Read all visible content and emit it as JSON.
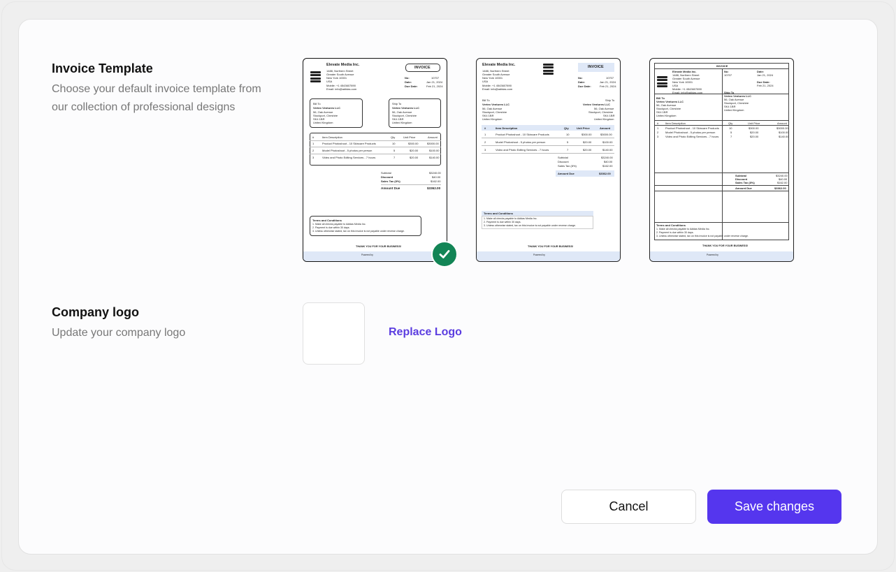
{
  "invoice_template": {
    "title": "Invoice Template",
    "description": "Choose your default invoice template from our collection of professional designs",
    "selected_index": 0
  },
  "company_logo": {
    "title": "Company logo",
    "description": "Update your company logo",
    "replace_label": "Replace Logo"
  },
  "actions": {
    "cancel_label": "Cancel",
    "save_label": "Save changes"
  },
  "colors": {
    "accent": "#5536ee",
    "link": "#5b3de0",
    "selected_check": "#138556"
  },
  "mini_invoice": {
    "company": "Elevate Media Inc.",
    "address": [
      "1488, Northern Street",
      "Greater South Avenue",
      "New York 10001",
      "USA"
    ],
    "mobile": "Mobile: +1 4543607890",
    "email": "Email: info@adidas.com",
    "heading": "INVOICE",
    "no_label": "No:",
    "no_value": "10707",
    "date_label": "Date:",
    "date_value": "Jan 21, 2024",
    "due_label": "Due Date:",
    "due_value": "Feb 21, 2024",
    "bill_to": "Bill To",
    "ship_to": "Ship To",
    "client": "Vertex Ventures LLC",
    "client_address": [
      "56, Oak Avenue",
      "Stockport, Cheshire",
      "SK4 1BR",
      "United Kingdom"
    ],
    "columns": [
      "#",
      "Item Description",
      "Qty",
      "Unit Price",
      "Amount"
    ],
    "rows": [
      [
        "1",
        "Product Photoshoot - 10 Skincare Products",
        "10",
        "$300.00",
        "$3000.00"
      ],
      [
        "2",
        "Model Photoshoot - 5 photos per person",
        "5",
        "$20.00",
        "$100.00"
      ],
      [
        "3",
        "Video and Photo Editing Services - 7 hours",
        "7",
        "$20.00",
        "$140.00"
      ]
    ],
    "subtotal_label": "Subtotal",
    "subtotal": "$3240.00",
    "discount_label": "Discount",
    "discount": "$40.00",
    "tax_label": "Sales Tax (8%)",
    "tax": "$162.00",
    "due_total_label": "Amount Due",
    "due_total": "$3362.00",
    "terms_title": "Terms and Conditions",
    "terms": [
      "1. Make all checks payable to Adidas Media Inc.",
      "2. Payment is due within 30 days.",
      "3. Unless otherwise stated, tax on this invoice is not payable under reverse charge."
    ],
    "thanks": "THANK YOU FOR YOUR BUSINESS!",
    "powered": "Powered by"
  }
}
